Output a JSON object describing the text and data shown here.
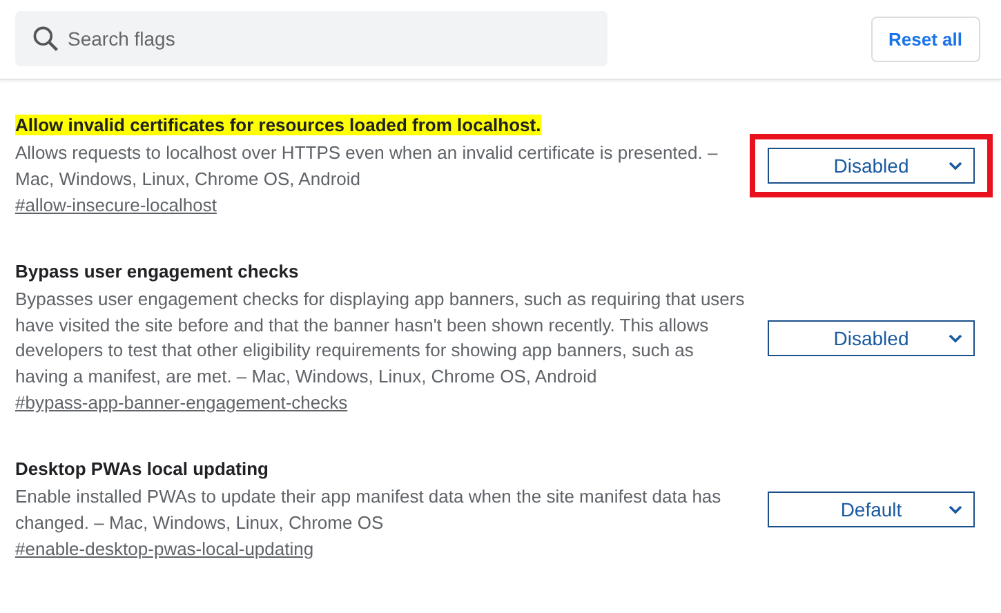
{
  "search": {
    "placeholder": "Search flags"
  },
  "reset_button": "Reset all",
  "flags": [
    {
      "title": "Allow invalid certificates for resources loaded from localhost.",
      "description": "Allows requests to localhost over HTTPS even when an invalid certificate is presented. – Mac, Windows, Linux, Chrome OS, Android",
      "link": "#allow-insecure-localhost",
      "value": "Disabled",
      "highlighted": true,
      "outlined": true
    },
    {
      "title": "Bypass user engagement checks",
      "description": "Bypasses user engagement checks for displaying app banners, such as requiring that users have visited the site before and that the banner hasn't been shown recently. This allows developers to test that other eligibility requirements for showing app banners, such as having a manifest, are met. – Mac, Windows, Linux, Chrome OS, Android",
      "link": "#bypass-app-banner-engagement-checks",
      "value": "Disabled",
      "highlighted": false,
      "outlined": false
    },
    {
      "title": "Desktop PWAs local updating",
      "description": "Enable installed PWAs to update their app manifest data when the site manifest data has changed. – Mac, Windows, Linux, Chrome OS",
      "link": "#enable-desktop-pwas-local-updating",
      "value": "Default",
      "highlighted": false,
      "outlined": false
    }
  ]
}
